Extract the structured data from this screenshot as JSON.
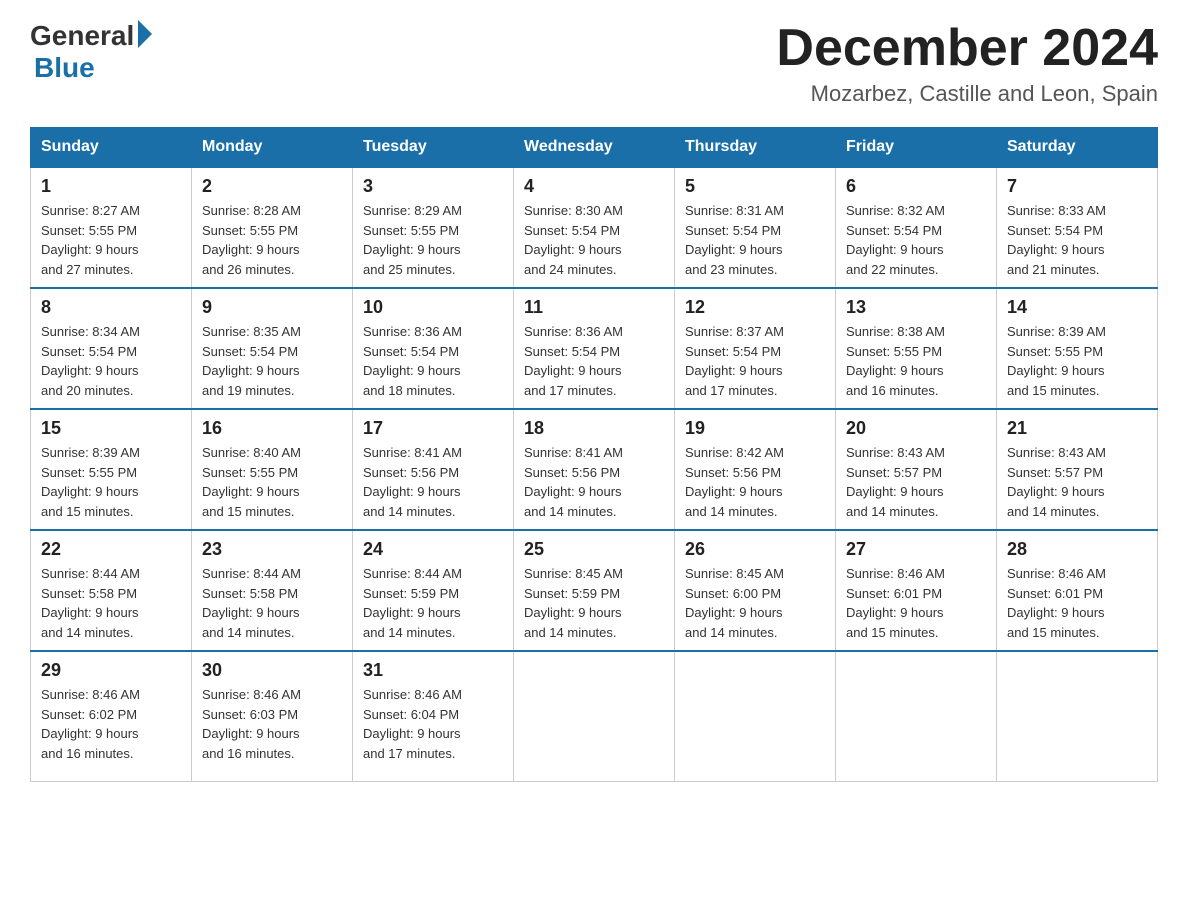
{
  "logo": {
    "general": "General",
    "blue": "Blue"
  },
  "title": "December 2024",
  "location": "Mozarbez, Castille and Leon, Spain",
  "days_of_week": [
    "Sunday",
    "Monday",
    "Tuesday",
    "Wednesday",
    "Thursday",
    "Friday",
    "Saturday"
  ],
  "weeks": [
    [
      {
        "day": "1",
        "sunrise": "8:27 AM",
        "sunset": "5:55 PM",
        "daylight": "9 hours and 27 minutes."
      },
      {
        "day": "2",
        "sunrise": "8:28 AM",
        "sunset": "5:55 PM",
        "daylight": "9 hours and 26 minutes."
      },
      {
        "day": "3",
        "sunrise": "8:29 AM",
        "sunset": "5:55 PM",
        "daylight": "9 hours and 25 minutes."
      },
      {
        "day": "4",
        "sunrise": "8:30 AM",
        "sunset": "5:54 PM",
        "daylight": "9 hours and 24 minutes."
      },
      {
        "day": "5",
        "sunrise": "8:31 AM",
        "sunset": "5:54 PM",
        "daylight": "9 hours and 23 minutes."
      },
      {
        "day": "6",
        "sunrise": "8:32 AM",
        "sunset": "5:54 PM",
        "daylight": "9 hours and 22 minutes."
      },
      {
        "day": "7",
        "sunrise": "8:33 AM",
        "sunset": "5:54 PM",
        "daylight": "9 hours and 21 minutes."
      }
    ],
    [
      {
        "day": "8",
        "sunrise": "8:34 AM",
        "sunset": "5:54 PM",
        "daylight": "9 hours and 20 minutes."
      },
      {
        "day": "9",
        "sunrise": "8:35 AM",
        "sunset": "5:54 PM",
        "daylight": "9 hours and 19 minutes."
      },
      {
        "day": "10",
        "sunrise": "8:36 AM",
        "sunset": "5:54 PM",
        "daylight": "9 hours and 18 minutes."
      },
      {
        "day": "11",
        "sunrise": "8:36 AM",
        "sunset": "5:54 PM",
        "daylight": "9 hours and 17 minutes."
      },
      {
        "day": "12",
        "sunrise": "8:37 AM",
        "sunset": "5:54 PM",
        "daylight": "9 hours and 17 minutes."
      },
      {
        "day": "13",
        "sunrise": "8:38 AM",
        "sunset": "5:55 PM",
        "daylight": "9 hours and 16 minutes."
      },
      {
        "day": "14",
        "sunrise": "8:39 AM",
        "sunset": "5:55 PM",
        "daylight": "9 hours and 15 minutes."
      }
    ],
    [
      {
        "day": "15",
        "sunrise": "8:39 AM",
        "sunset": "5:55 PM",
        "daylight": "9 hours and 15 minutes."
      },
      {
        "day": "16",
        "sunrise": "8:40 AM",
        "sunset": "5:55 PM",
        "daylight": "9 hours and 15 minutes."
      },
      {
        "day": "17",
        "sunrise": "8:41 AM",
        "sunset": "5:56 PM",
        "daylight": "9 hours and 14 minutes."
      },
      {
        "day": "18",
        "sunrise": "8:41 AM",
        "sunset": "5:56 PM",
        "daylight": "9 hours and 14 minutes."
      },
      {
        "day": "19",
        "sunrise": "8:42 AM",
        "sunset": "5:56 PM",
        "daylight": "9 hours and 14 minutes."
      },
      {
        "day": "20",
        "sunrise": "8:43 AM",
        "sunset": "5:57 PM",
        "daylight": "9 hours and 14 minutes."
      },
      {
        "day": "21",
        "sunrise": "8:43 AM",
        "sunset": "5:57 PM",
        "daylight": "9 hours and 14 minutes."
      }
    ],
    [
      {
        "day": "22",
        "sunrise": "8:44 AM",
        "sunset": "5:58 PM",
        "daylight": "9 hours and 14 minutes."
      },
      {
        "day": "23",
        "sunrise": "8:44 AM",
        "sunset": "5:58 PM",
        "daylight": "9 hours and 14 minutes."
      },
      {
        "day": "24",
        "sunrise": "8:44 AM",
        "sunset": "5:59 PM",
        "daylight": "9 hours and 14 minutes."
      },
      {
        "day": "25",
        "sunrise": "8:45 AM",
        "sunset": "5:59 PM",
        "daylight": "9 hours and 14 minutes."
      },
      {
        "day": "26",
        "sunrise": "8:45 AM",
        "sunset": "6:00 PM",
        "daylight": "9 hours and 14 minutes."
      },
      {
        "day": "27",
        "sunrise": "8:46 AM",
        "sunset": "6:01 PM",
        "daylight": "9 hours and 15 minutes."
      },
      {
        "day": "28",
        "sunrise": "8:46 AM",
        "sunset": "6:01 PM",
        "daylight": "9 hours and 15 minutes."
      }
    ],
    [
      {
        "day": "29",
        "sunrise": "8:46 AM",
        "sunset": "6:02 PM",
        "daylight": "9 hours and 16 minutes."
      },
      {
        "day": "30",
        "sunrise": "8:46 AM",
        "sunset": "6:03 PM",
        "daylight": "9 hours and 16 minutes."
      },
      {
        "day": "31",
        "sunrise": "8:46 AM",
        "sunset": "6:04 PM",
        "daylight": "9 hours and 17 minutes."
      },
      null,
      null,
      null,
      null
    ]
  ]
}
